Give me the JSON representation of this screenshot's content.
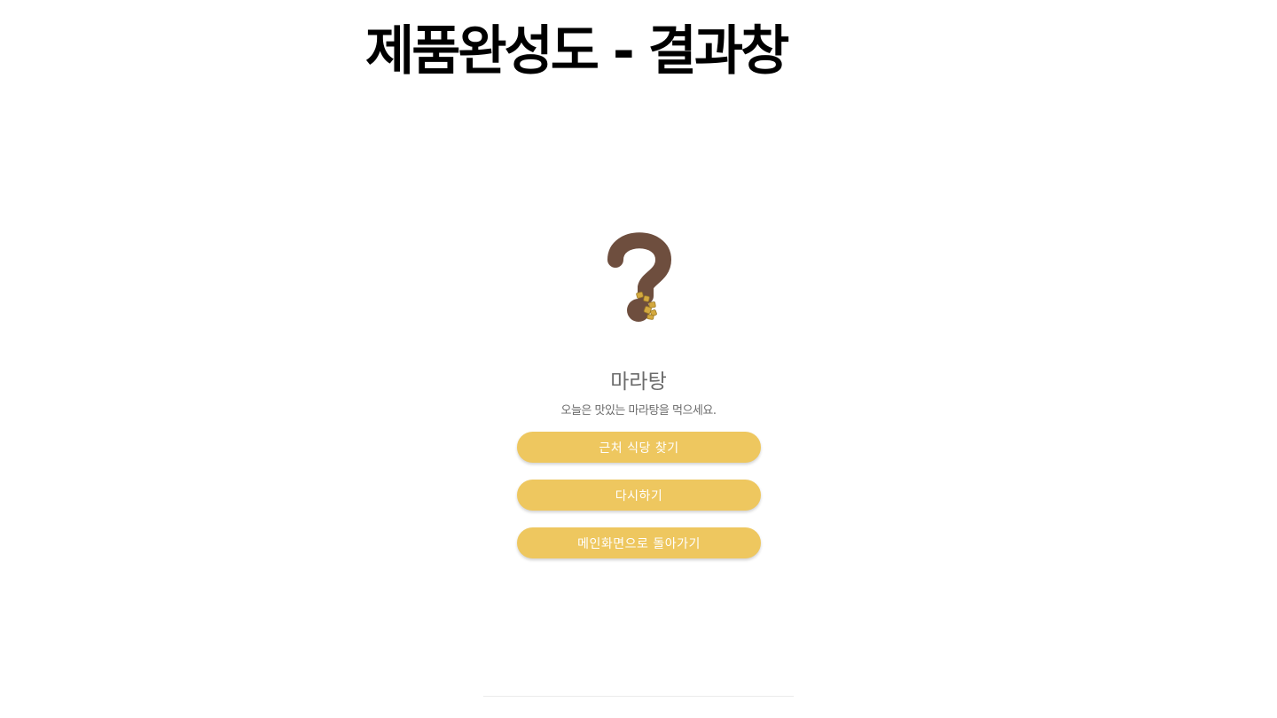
{
  "page": {
    "title": "제품완성도 - 결과창"
  },
  "result": {
    "icon": "question-mark-icon",
    "name": "마라탕",
    "description": "오늘은 맛있는 마라탕을 먹으세요."
  },
  "buttons": {
    "find_restaurant": "근처 식당 찾기",
    "retry": "다시하기",
    "home": "메인화면으로 돌아가기"
  },
  "colors": {
    "button": "#eec75f",
    "icon_brown": "#6e4e3e",
    "icon_gold": "#d4a93f",
    "text_gray": "#6b6b6b"
  }
}
